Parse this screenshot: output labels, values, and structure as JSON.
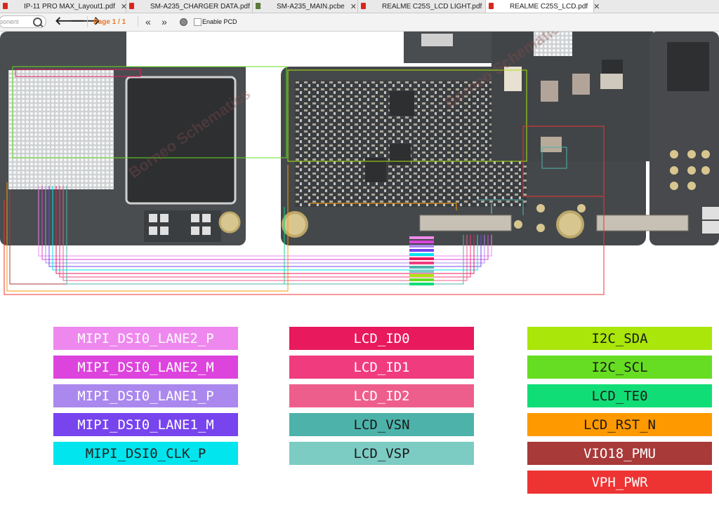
{
  "tabs": [
    {
      "label": "IP-11 PRO MAX_Layout1.pdf",
      "icon": "pdf-icon",
      "active": false
    },
    {
      "label": "SM-A235_CHARGER DATA.pdf",
      "icon": "pdf-icon",
      "active": false
    },
    {
      "label": "SM-A235_MAIN.pcbe",
      "icon": "pcb-file-icon",
      "active": false
    },
    {
      "label": "REALME C25S_LCD LIGHT.pdf",
      "icon": "pdf-icon",
      "active": false
    },
    {
      "label": "REALME C25S_LCD.pdf",
      "icon": "pdf-icon",
      "active": true
    }
  ],
  "toolbar": {
    "search_placeholder": "ponent",
    "back_glyph": "🡐",
    "forward_glyph": "🡒",
    "page_indicator": "Page 1 / 1",
    "first_glyph": "«",
    "last_glyph": "»",
    "enable_pcd_label": "Enable PCD",
    "enable_pcd_checked": false
  },
  "watermark": "Borneo Schematics",
  "legend": {
    "col1": [
      {
        "label": "MIPI_DSI0_LANE2_P",
        "bg": "#ee88ee",
        "fg": "#ffffff"
      },
      {
        "label": "MIPI_DSI0_LANE2_M",
        "bg": "#dd44dd",
        "fg": "#ffffff"
      },
      {
        "label": "MIPI_DSI0_LANE1_P",
        "bg": "#aa88ee",
        "fg": "#ffffff"
      },
      {
        "label": "MIPI_DSI0_LANE1_M",
        "bg": "#7744ee",
        "fg": "#ffffff"
      },
      {
        "label": "MIPI_DSI0_CLK_P",
        "bg": "#00e5ee",
        "fg": "#222222"
      }
    ],
    "col2": [
      {
        "label": "LCD_ID0",
        "bg": "#e8195c",
        "fg": "#ffffff"
      },
      {
        "label": "LCD_ID1",
        "bg": "#f03c7e",
        "fg": "#ffffff"
      },
      {
        "label": "LCD_ID2",
        "bg": "#ee5e8c",
        "fg": "#ffffff"
      },
      {
        "label": "LCD_VSN",
        "bg": "#4db3aa",
        "fg": "#1a1a1a"
      },
      {
        "label": "LCD_VSP",
        "bg": "#7cccc4",
        "fg": "#1a1a1a"
      }
    ],
    "col3": [
      {
        "label": "I2C_SDA",
        "bg": "#aae60a",
        "fg": "#1a1a1a"
      },
      {
        "label": "I2C_SCL",
        "bg": "#66dd22",
        "fg": "#1a1a1a"
      },
      {
        "label": "LCD_TE0",
        "bg": "#11dd77",
        "fg": "#1a1a1a"
      },
      {
        "label": "LCD_RST_N",
        "bg": "#ff9900",
        "fg": "#1a1a1a"
      },
      {
        "label": "VIO18_PMU",
        "bg": "#a83a3a",
        "fg": "#ffffff"
      },
      {
        "label": "VPH_PWR",
        "bg": "#ee3333",
        "fg": "#ffffff"
      }
    ]
  }
}
